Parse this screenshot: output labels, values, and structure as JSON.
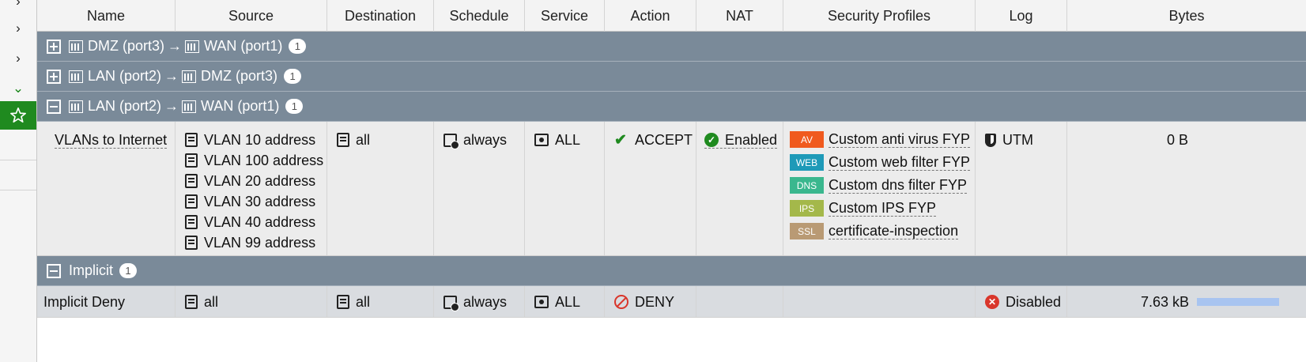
{
  "sidebar": {
    "chevrons": [
      "›",
      "›",
      "›",
      "⌄"
    ],
    "active_icon": "star-icon"
  },
  "columns": [
    "Name",
    "Source",
    "Destination",
    "Schedule",
    "Service",
    "Action",
    "NAT",
    "Security Profiles",
    "Log",
    "Bytes"
  ],
  "groups": [
    {
      "from": "DMZ (port3)",
      "arrow": "→",
      "to": "WAN (port1)",
      "count": "1",
      "state": "collapsed"
    },
    {
      "from": "LAN (port2)",
      "arrow": "→",
      "to": "DMZ (port3)",
      "count": "1",
      "state": "collapsed"
    },
    {
      "from": "LAN (port2)",
      "arrow": "→",
      "to": "WAN (port1)",
      "count": "1",
      "state": "expanded"
    }
  ],
  "policy": {
    "name": "VLANs to Internet",
    "sources": [
      "VLAN 10 address",
      "VLAN 100 address",
      "VLAN 20 address",
      "VLAN 30 address",
      "VLAN 40 address",
      "VLAN 99 address"
    ],
    "destination": "all",
    "schedule": "always",
    "service": "ALL",
    "action": "ACCEPT",
    "nat": "Enabled",
    "profiles": [
      {
        "badge": "AV",
        "label": "Custom anti virus FYP",
        "color": "#f05a1e"
      },
      {
        "badge": "WEB",
        "label": "Custom web filter FYP",
        "color": "#1e9ab8"
      },
      {
        "badge": "DNS",
        "label": "Custom dns filter FYP",
        "color": "#3ab78e"
      },
      {
        "badge": "IPS",
        "label": "Custom IPS FYP",
        "color": "#a4b84a"
      },
      {
        "badge": "SSL",
        "label": "certificate-inspection",
        "color": "#b99a74"
      }
    ],
    "log": "UTM",
    "bytes": "0 B"
  },
  "implicit_group": {
    "label": "Implicit",
    "count": "1"
  },
  "implicit_policy": {
    "name": "Implicit Deny",
    "source": "all",
    "destination": "all",
    "schedule": "always",
    "service": "ALL",
    "action": "DENY",
    "log": "Disabled",
    "bytes": "7.63 kB"
  }
}
